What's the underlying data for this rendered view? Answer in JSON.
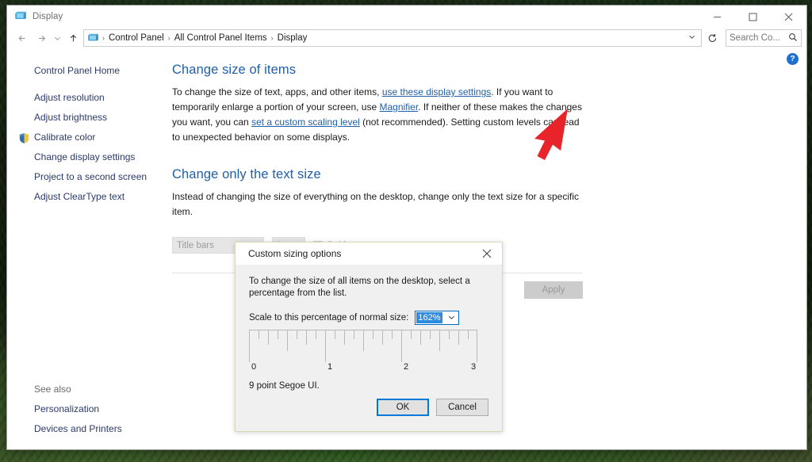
{
  "window": {
    "title": "Display",
    "icon": "display-monitor-icon",
    "controls": {
      "minimize": "–",
      "maximize": "□",
      "close": "✕"
    }
  },
  "addressbar": {
    "back": "←",
    "forward": "→",
    "recent": "⌄",
    "up": "↑",
    "crumb_icon": "display-monitor-icon",
    "crumbs": [
      "Control Panel",
      "All Control Panel Items",
      "Display"
    ],
    "separator": "›",
    "dropdown": "⌄",
    "refresh": "↻",
    "search_placeholder": "Search Co...",
    "search_value": "",
    "search_icon": "magnifier-icon"
  },
  "sidebar": {
    "home": "Control Panel Home",
    "items": [
      {
        "label": "Adjust resolution",
        "shield": false
      },
      {
        "label": "Adjust brightness",
        "shield": false
      },
      {
        "label": "Calibrate color",
        "shield": true
      },
      {
        "label": "Change display settings",
        "shield": false
      },
      {
        "label": "Project to a second screen",
        "shield": false
      },
      {
        "label": "Adjust ClearType text",
        "shield": false
      }
    ],
    "see_also_header": "See also",
    "see_also": [
      "Personalization",
      "Devices and Printers"
    ]
  },
  "content": {
    "section1_title": "Change size of items",
    "section1_text": {
      "a": "To change the size of text, apps, and other items, ",
      "link1": "use these display settings",
      "b": ".  If you want to temporarily enlarge a portion of your screen, use ",
      "link2": "Magnifier",
      "c": ".  If neither of these makes the changes you want, you can ",
      "link3": "set a custom scaling level",
      "d": " (not recommended).  Setting custom levels can lead to unexpected behavior on some displays."
    },
    "section2_title": "Change only the text size",
    "section2_text": "Instead of changing the size of everything on the desktop, change only the text size for a specific item.",
    "item_dropdown_value": "Title bars",
    "size_dropdown_value": "9",
    "bold_label": "Bold",
    "bold_checked": false,
    "apply_label": "Apply",
    "apply_disabled": true,
    "help_label": "?"
  },
  "dialog": {
    "title": "Custom sizing options",
    "close_icon": "✕",
    "description": "To change the size of all items on the desktop, select a percentage from the list.",
    "scale_label": "Scale to this percentage of normal size:",
    "scale_value": "162%",
    "scale_chevron": "⌄",
    "ruler_labels": [
      "0",
      "1",
      "2",
      "3"
    ],
    "sample_text": "9 point Segoe UI.",
    "ok_label": "OK",
    "cancel_label": "Cancel"
  },
  "cursor": {
    "name": "red-arrow-pointer",
    "color": "#e8232a"
  },
  "colors": {
    "link": "#1f5fa8",
    "heading": "#1f5fa8",
    "accent": "#0078d7",
    "selection": "#2d8ce0",
    "dialog_border": "#d8d8b4",
    "help_blue": "#1f6fd0"
  }
}
